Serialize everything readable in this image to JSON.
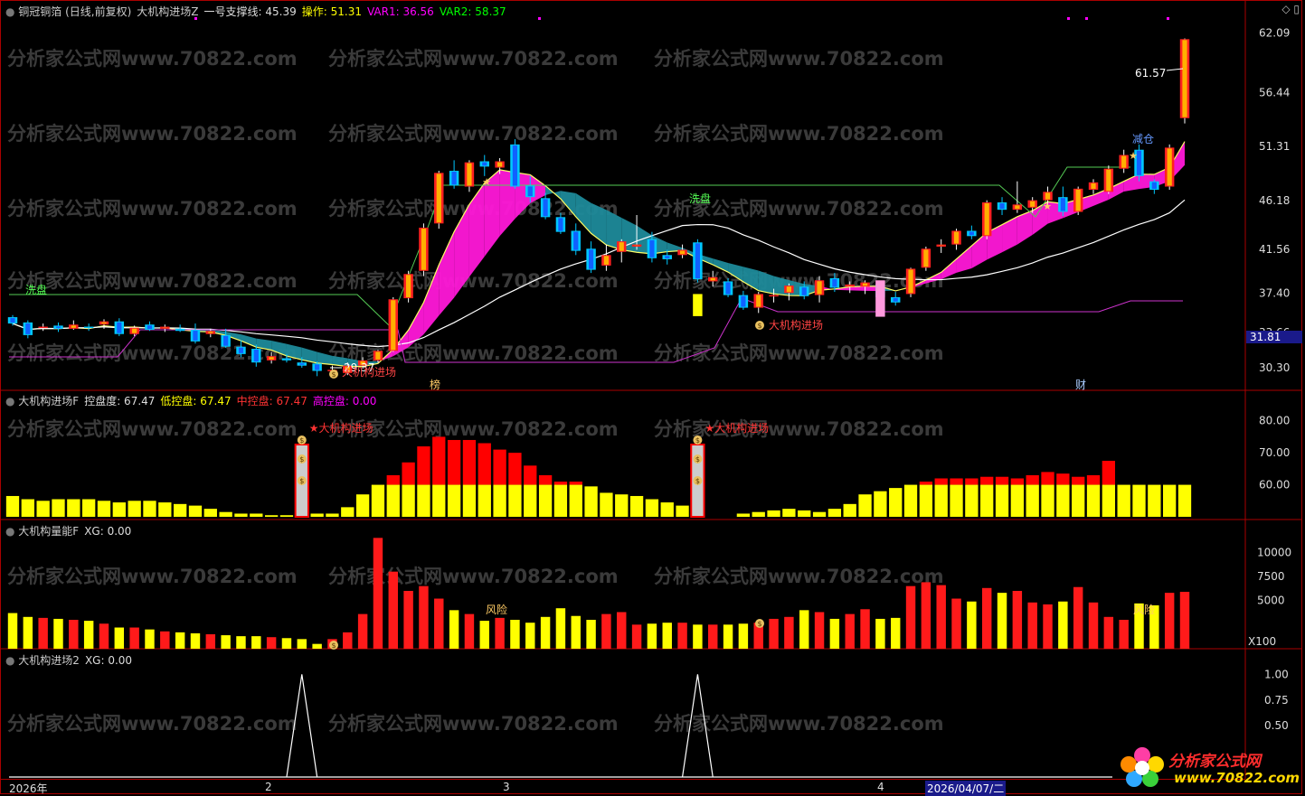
{
  "main_panel": {
    "title_parts": [
      {
        "text": "铜冠铜箔 (日线,前复权)",
        "color": "#cccccc"
      },
      {
        "text": "大机构进场Z",
        "color": "#cccccc"
      },
      {
        "text": "一号支撑线: 45.39",
        "color": "#dddddd"
      },
      {
        "text": "操作: 51.31",
        "color": "#ffff00"
      },
      {
        "text": "VAR1: 36.56",
        "color": "#ff00ff"
      },
      {
        "text": "VAR2: 58.37",
        "color": "#00ff00"
      }
    ],
    "y_labels": [
      "62.09",
      "56.44",
      "51.31",
      "46.18",
      "41.56",
      "37.40",
      "33.66",
      "30.30"
    ],
    "price_tag": "31.81",
    "annotations": {
      "wash_left": "洗盘",
      "wash_right": "洗盘",
      "low_price": "29.37",
      "high_price": "61.57",
      "entry1": "大机构进场",
      "entry2": "大机构进场",
      "reduce": "减仓",
      "char1": "榜",
      "char2": "财"
    }
  },
  "panel2": {
    "title_parts": [
      {
        "text": "大机构进场F",
        "color": "#cccccc"
      },
      {
        "text": "控盘度: 67.47",
        "color": "#dddddd"
      },
      {
        "text": "低控盘: 67.47",
        "color": "#ffff00"
      },
      {
        "text": "中控盘: 67.47",
        "color": "#ff3333"
      },
      {
        "text": "高控盘: 0.00",
        "color": "#ff00ff"
      }
    ],
    "y_labels": [
      "80.00",
      "70.00",
      "60.00"
    ],
    "entry1": "★大机构进场",
    "entry2": "★大机构进场"
  },
  "panel3": {
    "title_parts": [
      {
        "text": "大机构量能F",
        "color": "#cccccc"
      },
      {
        "text": "XG: 0.00",
        "color": "#dddddd"
      }
    ],
    "y_labels": [
      "10000",
      "7500",
      "5000",
      "X100"
    ],
    "risk1": "风险",
    "risk2": "风险"
  },
  "panel4": {
    "title_parts": [
      {
        "text": "大机构进场2",
        "color": "#cccccc"
      },
      {
        "text": "XG: 0.00",
        "color": "#dddddd"
      }
    ],
    "y_labels": [
      "1.00",
      "0.75",
      "0.50"
    ]
  },
  "x_axis": [
    "2026年",
    "2",
    "3",
    "4",
    "2026/04/07/二"
  ],
  "watermark": "分析家公式网www.70822.com",
  "logo": {
    "line1": "分析家公式网",
    "line2": "www.70822.com"
  },
  "icons": [
    "diamond-icon",
    "window-icon"
  ],
  "chart_data": [
    {
      "type": "candlestick",
      "title": "铜冠铜箔 (日线,前复权)",
      "ylim": [
        29,
        63
      ],
      "y_ticks": [
        62.09,
        56.44,
        51.31,
        46.18,
        41.56,
        37.4,
        33.66,
        30.3
      ],
      "ohlc": [
        [
          35.1,
          35.3,
          34.3,
          34.5
        ],
        [
          34.6,
          34.8,
          33.1,
          33.4
        ],
        [
          34.1,
          34.5,
          33.8,
          34.2
        ],
        [
          34.3,
          34.6,
          33.7,
          34.0
        ],
        [
          34.0,
          34.8,
          33.9,
          34.4
        ],
        [
          34.2,
          34.5,
          33.8,
          34.1
        ],
        [
          34.4,
          34.9,
          34.0,
          34.7
        ],
        [
          34.7,
          35.0,
          33.3,
          33.5
        ],
        [
          33.5,
          34.3,
          33.3,
          34.1
        ],
        [
          34.4,
          34.7,
          33.8,
          33.9
        ],
        [
          34.0,
          34.4,
          33.7,
          34.2
        ],
        [
          34.0,
          34.4,
          33.7,
          33.8
        ],
        [
          33.9,
          34.5,
          32.6,
          32.8
        ],
        [
          33.5,
          34.0,
          33.2,
          33.8
        ],
        [
          33.4,
          34.0,
          32.2,
          32.3
        ],
        [
          32.3,
          32.9,
          31.3,
          31.6
        ],
        [
          32.1,
          32.5,
          30.4,
          30.8
        ],
        [
          31.0,
          31.8,
          30.7,
          31.4
        ],
        [
          31.2,
          31.6,
          30.8,
          31.0
        ],
        [
          30.8,
          31.3,
          30.3,
          30.5
        ],
        [
          30.7,
          30.9,
          29.5,
          30.0
        ],
        [
          30.1,
          30.5,
          29.4,
          30.1
        ],
        [
          29.8,
          30.8,
          29.6,
          30.5
        ],
        [
          30.5,
          31.3,
          30.2,
          31.0
        ],
        [
          31.0,
          32.0,
          30.8,
          31.9
        ],
        [
          31.9,
          37.0,
          31.8,
          36.8
        ],
        [
          36.9,
          39.5,
          36.5,
          39.2
        ],
        [
          39.5,
          44.0,
          39.0,
          43.6
        ],
        [
          44.0,
          49.0,
          43.5,
          48.8
        ],
        [
          49.0,
          50.0,
          47.3,
          47.6
        ],
        [
          47.5,
          50.0,
          47.0,
          49.8
        ],
        [
          49.9,
          50.5,
          48.5,
          49.4
        ],
        [
          49.3,
          50.2,
          48.7,
          49.9
        ],
        [
          51.5,
          52.0,
          47.3,
          47.5
        ],
        [
          47.6,
          48.5,
          46.0,
          46.5
        ],
        [
          46.4,
          46.9,
          44.4,
          44.6
        ],
        [
          44.6,
          45.0,
          43.0,
          43.2
        ],
        [
          43.3,
          44.0,
          41.0,
          41.4
        ],
        [
          41.6,
          42.3,
          39.3,
          39.6
        ],
        [
          40.0,
          42.0,
          39.5,
          41.0
        ],
        [
          41.3,
          42.5,
          40.3,
          42.3
        ],
        [
          41.8,
          44.8,
          41.5,
          42.0
        ],
        [
          42.5,
          43.2,
          40.3,
          40.7
        ],
        [
          41.0,
          41.5,
          40.1,
          40.6
        ],
        [
          41.0,
          42.0,
          40.7,
          41.5
        ],
        [
          42.2,
          42.5,
          38.4,
          38.7
        ],
        [
          38.5,
          39.5,
          38.0,
          38.9
        ],
        [
          38.5,
          38.8,
          37.0,
          37.2
        ],
        [
          37.2,
          37.6,
          35.8,
          36.0
        ],
        [
          36.0,
          37.5,
          35.5,
          37.3
        ],
        [
          37.1,
          37.8,
          36.5,
          37.2
        ],
        [
          37.4,
          38.3,
          36.7,
          38.1
        ],
        [
          38.0,
          38.5,
          36.8,
          37.1
        ],
        [
          37.2,
          39.0,
          36.5,
          38.6
        ],
        [
          38.8,
          39.3,
          37.5,
          37.9
        ],
        [
          38.0,
          38.5,
          37.4,
          38.2
        ],
        [
          38.0,
          38.6,
          37.3,
          38.4
        ],
        [
          38.2,
          38.5,
          36.8,
          37.0
        ],
        [
          37.0,
          37.5,
          36.2,
          36.5
        ],
        [
          37.3,
          39.8,
          37.0,
          39.7
        ],
        [
          39.8,
          41.8,
          39.5,
          41.6
        ],
        [
          41.8,
          42.5,
          41.2,
          42.0
        ],
        [
          42.0,
          43.5,
          41.5,
          43.3
        ],
        [
          43.3,
          43.8,
          42.5,
          42.8
        ],
        [
          42.8,
          46.2,
          42.5,
          46.0
        ],
        [
          46.0,
          46.5,
          44.8,
          45.3
        ],
        [
          45.3,
          48.0,
          45.0,
          45.8
        ],
        [
          45.5,
          46.5,
          45.0,
          46.2
        ],
        [
          46.2,
          47.5,
          45.5,
          47.0
        ],
        [
          46.5,
          47.5,
          44.7,
          45.1
        ],
        [
          45.1,
          47.5,
          44.8,
          47.3
        ],
        [
          47.2,
          48.2,
          46.8,
          47.9
        ],
        [
          47.0,
          49.5,
          46.8,
          49.2
        ],
        [
          49.2,
          51.0,
          48.8,
          50.5
        ],
        [
          51.0,
          51.5,
          48.0,
          48.5
        ],
        [
          48.0,
          48.2,
          46.8,
          47.2
        ],
        [
          47.5,
          51.5,
          47.2,
          51.2
        ],
        [
          54.0,
          61.57,
          53.5,
          61.5
        ]
      ]
    },
    {
      "type": "bar",
      "title": "控盘度",
      "ylim": [
        50,
        85
      ],
      "y_ticks": [
        80,
        70,
        60
      ],
      "series": [
        {
          "name": "低控盘",
          "values": [
            56.5,
            55.5,
            55,
            55.5,
            55.5,
            55.5,
            55,
            54.5,
            55,
            55,
            54.5,
            54,
            53.5,
            52.5,
            51.5,
            51,
            51,
            50.5,
            50.5,
            0,
            51,
            51,
            53,
            57,
            60,
            60,
            60,
            60,
            60,
            60,
            60,
            60,
            60,
            60,
            60,
            60,
            60,
            60,
            59.5,
            57.5,
            57,
            56.5,
            55.5,
            54.5,
            53.5,
            53,
            0,
            0,
            51,
            51.5,
            52,
            52.5,
            52,
            51.5,
            52.5,
            54,
            57,
            58,
            59,
            60,
            60,
            60,
            60,
            60,
            60,
            60,
            60,
            60,
            60,
            60,
            60,
            60,
            60,
            60,
            60,
            60,
            60,
            60
          ]
        },
        {
          "name": "中控盘",
          "values": [
            0,
            0,
            0,
            0,
            0,
            0,
            0,
            0,
            0,
            0,
            0,
            0,
            0,
            0,
            0,
            0,
            0,
            0,
            0,
            0,
            0,
            0,
            0,
            0,
            0,
            63,
            67,
            72,
            75,
            74,
            74,
            73,
            71,
            70,
            66,
            63,
            61,
            61,
            60,
            0,
            0,
            0,
            0,
            0,
            0,
            0,
            0,
            0,
            0,
            0,
            0,
            0,
            0,
            0,
            0,
            0,
            0,
            0,
            0,
            60,
            61,
            62,
            62,
            62,
            62.5,
            62.5,
            62,
            63,
            64,
            63.5,
            62.5,
            63,
            67.5,
            0,
            0,
            0,
            0,
            0
          ]
        }
      ]
    },
    {
      "type": "bar",
      "title": "大机构量能F",
      "ylim": [
        0,
        12000
      ],
      "y_ticks": [
        10000,
        7500,
        5000
      ],
      "values": [
        3700,
        3300,
        3200,
        3100,
        3000,
        2900,
        2600,
        2200,
        2200,
        2000,
        1800,
        1700,
        1600,
        1500,
        1400,
        1300,
        1300,
        1200,
        1100,
        1000,
        500,
        1000,
        1700,
        3600,
        11500,
        8000,
        6000,
        6500,
        5200,
        4000,
        3600,
        2900,
        3200,
        3000,
        2700,
        3300,
        4200,
        3400,
        3000,
        3600,
        3800,
        2500,
        2600,
        2700,
        2700,
        2500,
        2500,
        2500,
        2600,
        2700,
        3100,
        3300,
        4000,
        3800,
        3100,
        3600,
        4100,
        3100,
        3200,
        6500,
        6900,
        6600,
        5200,
        4900,
        6300,
        5800,
        6000,
        4800,
        4600,
        4900,
        6400,
        4800,
        3300,
        3000,
        4700,
        4500,
        5800,
        5900
      ]
    },
    {
      "type": "line",
      "title": "大机构进场2",
      "ylim": [
        0,
        1.1
      ],
      "y_ticks": [
        1.0,
        0.75,
        0.5
      ],
      "values": [
        0,
        0,
        0,
        0,
        0,
        0,
        0,
        0,
        0,
        0,
        0,
        0,
        0,
        0,
        0,
        0,
        0,
        0,
        0,
        1,
        0,
        0,
        0,
        0,
        0,
        0,
        0,
        0,
        0,
        0,
        0,
        0,
        0,
        0,
        0,
        0,
        0,
        0,
        0,
        0,
        0,
        0,
        0,
        0,
        0,
        1,
        0,
        0,
        0,
        0,
        0,
        0,
        0,
        0,
        0,
        0,
        0,
        0,
        0,
        0,
        0,
        0,
        0,
        0,
        0,
        0,
        0,
        0,
        0,
        0,
        0,
        0,
        0,
        0,
        0,
        0,
        0,
        0
      ]
    }
  ]
}
